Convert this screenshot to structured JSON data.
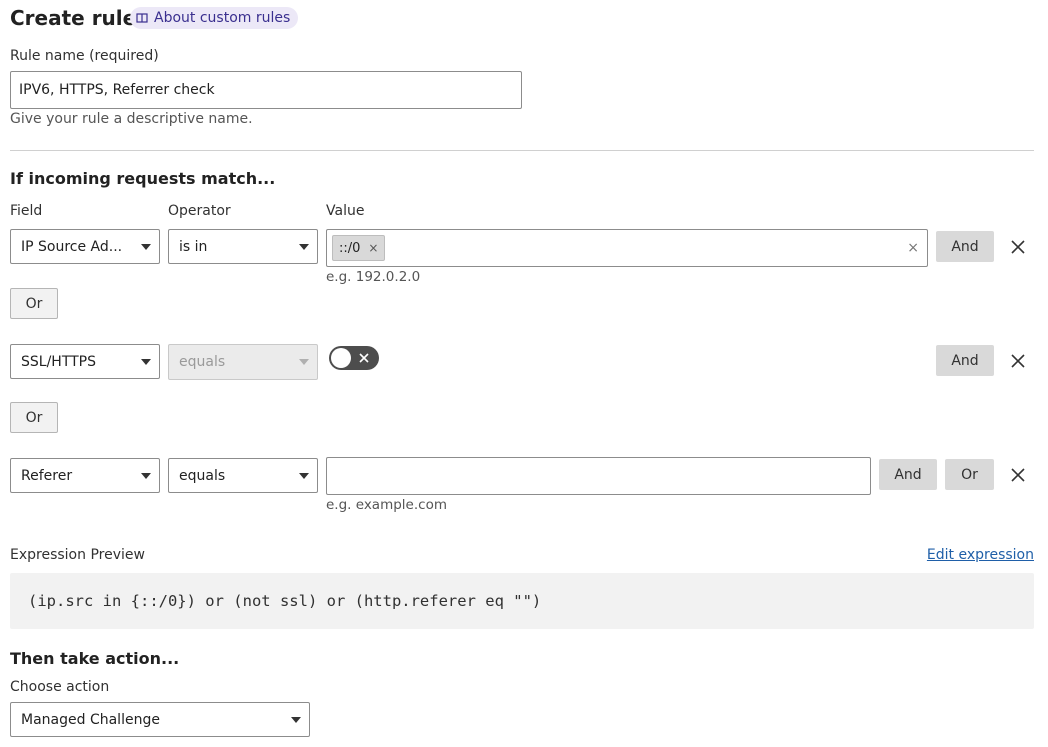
{
  "header": {
    "title": "Create rule",
    "doc_link": "About custom rules"
  },
  "rule_name": {
    "label": "Rule name (required)",
    "value": "IPV6, HTTPS, Referrer check",
    "help": "Give your rule a descriptive name."
  },
  "match": {
    "heading": "If incoming requests match...",
    "col_field": "Field",
    "col_operator": "Operator",
    "col_value": "Value",
    "row1": {
      "field": "IP Source Ad...",
      "operator": "is in",
      "chip": "::/0",
      "example": "e.g. 192.0.2.0",
      "and": "And",
      "or": "Or"
    },
    "row2": {
      "field": "SSL/HTTPS",
      "operator": "equals",
      "and": "And",
      "or": "Or"
    },
    "row3": {
      "field": "Referer",
      "operator": "equals",
      "value": "",
      "example": "e.g. example.com",
      "and": "And",
      "or": "Or"
    }
  },
  "preview": {
    "label": "Expression Preview",
    "edit": "Edit expression",
    "expression": "(ip.src in {::/0}) or (not ssl) or (http.referer eq \"\")"
  },
  "action": {
    "heading": "Then take action...",
    "label": "Choose action",
    "value": "Managed Challenge"
  }
}
